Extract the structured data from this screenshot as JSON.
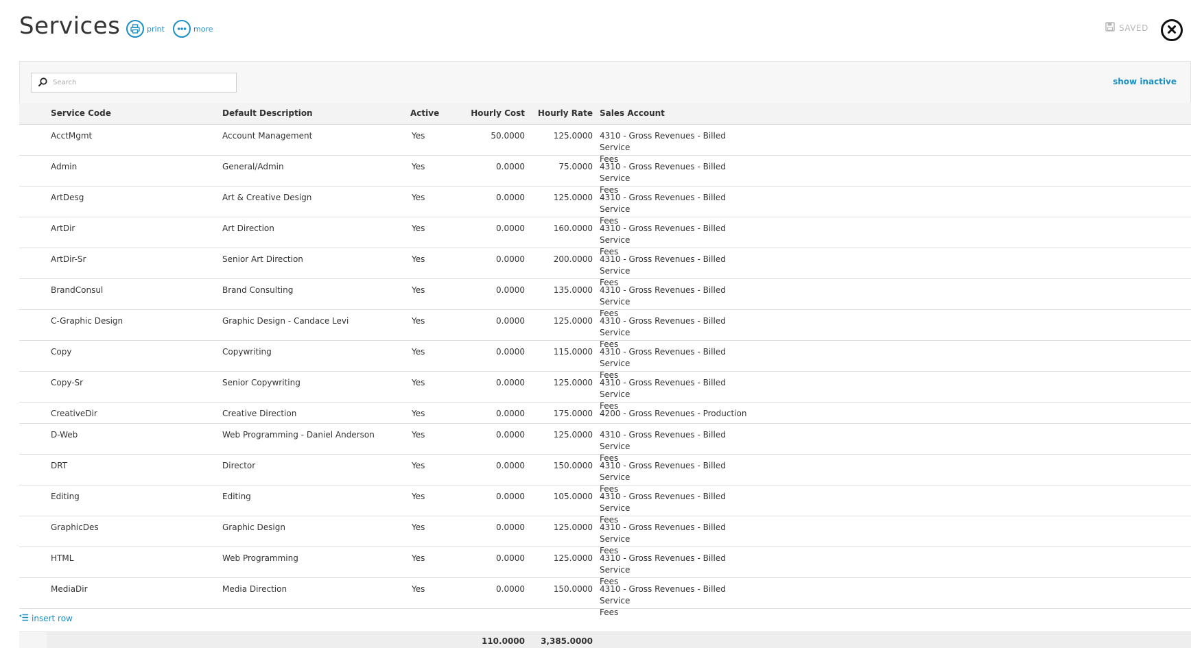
{
  "header": {
    "title": "Services",
    "print_label": "print",
    "more_label": "more",
    "saved_label": "SAVED"
  },
  "toolbar": {
    "search_placeholder": "Search",
    "show_inactive_label": "show inactive"
  },
  "table": {
    "columns": {
      "code": "Service Code",
      "description": "Default Description",
      "active": "Active",
      "hourly_cost": "Hourly Cost",
      "hourly_rate": "Hourly Rate",
      "sales_account": "Sales Account"
    },
    "rows": [
      {
        "code": "AcctMgmt",
        "description": "Account Management",
        "active": "Yes",
        "hourly_cost": "50.0000",
        "hourly_rate": "125.0000",
        "account_line1": "4310 - Gross Revenues - Billed Service",
        "account_line2": "Fees"
      },
      {
        "code": "Admin",
        "description": "General/Admin",
        "active": "Yes",
        "hourly_cost": "0.0000",
        "hourly_rate": "75.0000",
        "account_line1": "4310 - Gross Revenues - Billed Service",
        "account_line2": "Fees"
      },
      {
        "code": "ArtDesg",
        "description": "Art & Creative Design",
        "active": "Yes",
        "hourly_cost": "0.0000",
        "hourly_rate": "125.0000",
        "account_line1": "4310 - Gross Revenues - Billed Service",
        "account_line2": "Fees"
      },
      {
        "code": "ArtDir",
        "description": "Art Direction",
        "active": "Yes",
        "hourly_cost": "0.0000",
        "hourly_rate": "160.0000",
        "account_line1": "4310 - Gross Revenues - Billed Service",
        "account_line2": "Fees"
      },
      {
        "code": "ArtDir-Sr",
        "description": "Senior Art Direction",
        "active": "Yes",
        "hourly_cost": "0.0000",
        "hourly_rate": "200.0000",
        "account_line1": "4310 - Gross Revenues - Billed Service",
        "account_line2": "Fees"
      },
      {
        "code": "BrandConsul",
        "description": "Brand Consulting",
        "active": "Yes",
        "hourly_cost": "0.0000",
        "hourly_rate": "135.0000",
        "account_line1": "4310 - Gross Revenues - Billed Service",
        "account_line2": "Fees"
      },
      {
        "code": "C-Graphic Design",
        "description": "Graphic Design - Candace Levi",
        "active": "Yes",
        "hourly_cost": "0.0000",
        "hourly_rate": "125.0000",
        "account_line1": "4310 - Gross Revenues - Billed Service",
        "account_line2": "Fees"
      },
      {
        "code": "Copy",
        "description": "Copywriting",
        "active": "Yes",
        "hourly_cost": "0.0000",
        "hourly_rate": "115.0000",
        "account_line1": "4310 - Gross Revenues - Billed Service",
        "account_line2": "Fees"
      },
      {
        "code": "Copy-Sr",
        "description": "Senior Copywriting",
        "active": "Yes",
        "hourly_cost": "0.0000",
        "hourly_rate": "125.0000",
        "account_line1": "4310 - Gross Revenues - Billed Service",
        "account_line2": "Fees"
      },
      {
        "code": "CreativeDir",
        "description": "Creative Direction",
        "active": "Yes",
        "hourly_cost": "0.0000",
        "hourly_rate": "175.0000",
        "account_line1": "4200 - Gross Revenues - Production",
        "account_line2": ""
      },
      {
        "code": "D-Web",
        "description": "Web Programming - Daniel Anderson",
        "active": "Yes",
        "hourly_cost": "0.0000",
        "hourly_rate": "125.0000",
        "account_line1": "4310 - Gross Revenues - Billed Service",
        "account_line2": "Fees"
      },
      {
        "code": "DRT",
        "description": "Director",
        "active": "Yes",
        "hourly_cost": "0.0000",
        "hourly_rate": "150.0000",
        "account_line1": "4310 - Gross Revenues - Billed Service",
        "account_line2": "Fees"
      },
      {
        "code": "Editing",
        "description": "Editing",
        "active": "Yes",
        "hourly_cost": "0.0000",
        "hourly_rate": "105.0000",
        "account_line1": "4310 - Gross Revenues - Billed Service",
        "account_line2": "Fees"
      },
      {
        "code": "GraphicDes",
        "description": "Graphic Design",
        "active": "Yes",
        "hourly_cost": "0.0000",
        "hourly_rate": "125.0000",
        "account_line1": "4310 - Gross Revenues - Billed Service",
        "account_line2": "Fees"
      },
      {
        "code": "HTML",
        "description": "Web Programming",
        "active": "Yes",
        "hourly_cost": "0.0000",
        "hourly_rate": "125.0000",
        "account_line1": "4310 - Gross Revenues - Billed Service",
        "account_line2": "Fees"
      },
      {
        "code": "MediaDir",
        "description": "Media Direction",
        "active": "Yes",
        "hourly_cost": "0.0000",
        "hourly_rate": "150.0000",
        "account_line1": "4310 - Gross Revenues - Billed Service",
        "account_line2": "Fees"
      }
    ],
    "insert_row_label": "insert row",
    "totals": {
      "hourly_cost": "110.0000",
      "hourly_rate": "3,385.0000"
    }
  },
  "colors": {
    "accent": "#1a8fc4",
    "saved_gray": "#b7b7b7"
  },
  "icons": {
    "print": "printer-icon",
    "more": "ellipsis-icon",
    "saved": "floppy-disk-icon",
    "close": "close-icon",
    "search": "search-icon",
    "insert": "insert-row-icon"
  }
}
